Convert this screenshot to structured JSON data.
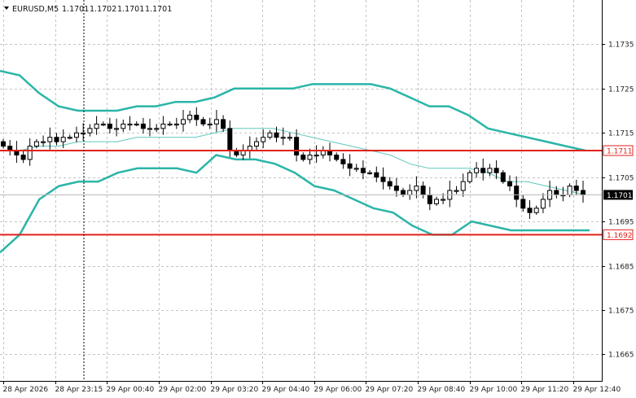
{
  "header": {
    "symbol_label": "EURUSD,M5",
    "ohlc_values": [
      "1.1701",
      "1.1702",
      "1.1701",
      "1.1701"
    ]
  },
  "colors": {
    "background": "#ffffff",
    "grid": "#c4c4c4",
    "bollinger": "#2ab5a8",
    "ma": "#5fc7bd",
    "level": "#e0221b",
    "price_box": "#000000",
    "candle": "#000000"
  },
  "chart_data": {
    "type": "candlestick",
    "instrument": "EURUSD",
    "timeframe": "M5",
    "ylim": [
      1.1659,
      1.1745
    ],
    "y_ticks": [
      "1.1735",
      "1.1725",
      "1.1715",
      "1.1705",
      "1.1695",
      "1.1685",
      "1.1675",
      "1.1665"
    ],
    "x_ticks": [
      "28 Apr 2026",
      "28 Apr 23:15",
      "29 Apr 00:40",
      "29 Apr 02:00",
      "29 Apr 03:20",
      "29 Apr 04:40",
      "29 Apr 06:00",
      "29 Apr 07:20",
      "29 Apr 08:40",
      "29 Apr 10:00",
      "29 Apr 11:20",
      "29 Apr 12:40"
    ],
    "levels": [
      {
        "value": 1.1711,
        "label": "1.1711"
      },
      {
        "value": 1.1692,
        "label": "1.1692"
      }
    ],
    "current_price": {
      "value": 1.1701,
      "label": "1.1701"
    },
    "bollinger_upper": [
      1.1729,
      1.1728,
      1.1724,
      1.1721,
      1.172,
      1.172,
      1.172,
      1.1721,
      1.1721,
      1.1722,
      1.1722,
      1.1723,
      1.1725,
      1.1725,
      1.1725,
      1.1725,
      1.1726,
      1.1726,
      1.1726,
      1.1726,
      1.1725,
      1.1723,
      1.1721,
      1.1721,
      1.1719,
      1.1716,
      1.1715,
      1.1714,
      1.1713,
      1.1712,
      1.1711
    ],
    "bollinger_lower": [
      1.1688,
      1.1692,
      1.17,
      1.1703,
      1.1704,
      1.1704,
      1.1706,
      1.1707,
      1.1707,
      1.1707,
      1.1706,
      1.171,
      1.1709,
      1.1709,
      1.1708,
      1.1706,
      1.1703,
      1.1702,
      1.17,
      1.1698,
      1.1697,
      1.1694,
      1.1692,
      1.1692,
      1.1695,
      1.1694,
      1.1693,
      1.1693,
      1.1693,
      1.1693,
      1.1693
    ],
    "moving_average": [
      1.1711,
      1.1711,
      1.1712,
      1.1712,
      1.1713,
      1.1713,
      1.1713,
      1.1714,
      1.1714,
      1.1714,
      1.1714,
      1.1715,
      1.1716,
      1.1716,
      1.1716,
      1.1715,
      1.1714,
      1.1713,
      1.1712,
      1.1711,
      1.171,
      1.1708,
      1.1707,
      1.1707,
      1.1707,
      1.1706,
      1.1704,
      1.1704,
      1.1703,
      1.1702,
      1.1701
    ],
    "candles_close": [
      1.1712,
      1.1711,
      1.171,
      1.1709,
      1.1712,
      1.1713,
      1.1713,
      1.1714,
      1.1713,
      1.1714,
      1.1714,
      1.1715,
      1.1715,
      1.1716,
      1.1717,
      1.1717,
      1.1716,
      1.1716,
      1.1717,
      1.1717,
      1.1717,
      1.1716,
      1.1716,
      1.1716,
      1.1717,
      1.1717,
      1.1717,
      1.1718,
      1.1719,
      1.1718,
      1.1717,
      1.1717,
      1.1718,
      1.1716,
      1.1711,
      1.171,
      1.1711,
      1.1712,
      1.1713,
      1.1714,
      1.1715,
      1.1714,
      1.1714,
      1.1714,
      1.171,
      1.1709,
      1.171,
      1.171,
      1.1711,
      1.171,
      1.1709,
      1.1708,
      1.1707,
      1.1707,
      1.1706,
      1.1706,
      1.1705,
      1.1704,
      1.1703,
      1.1702,
      1.1701,
      1.1702,
      1.1703,
      1.1701,
      1.1699,
      1.17,
      1.17,
      1.1702,
      1.1702,
      1.1704,
      1.1706,
      1.1707,
      1.1706,
      1.1707,
      1.1706,
      1.1704,
      1.1703,
      1.17,
      1.1698,
      1.1697,
      1.1698,
      1.17,
      1.1702,
      1.1701,
      1.1701,
      1.1703,
      1.1702,
      1.1701
    ]
  }
}
